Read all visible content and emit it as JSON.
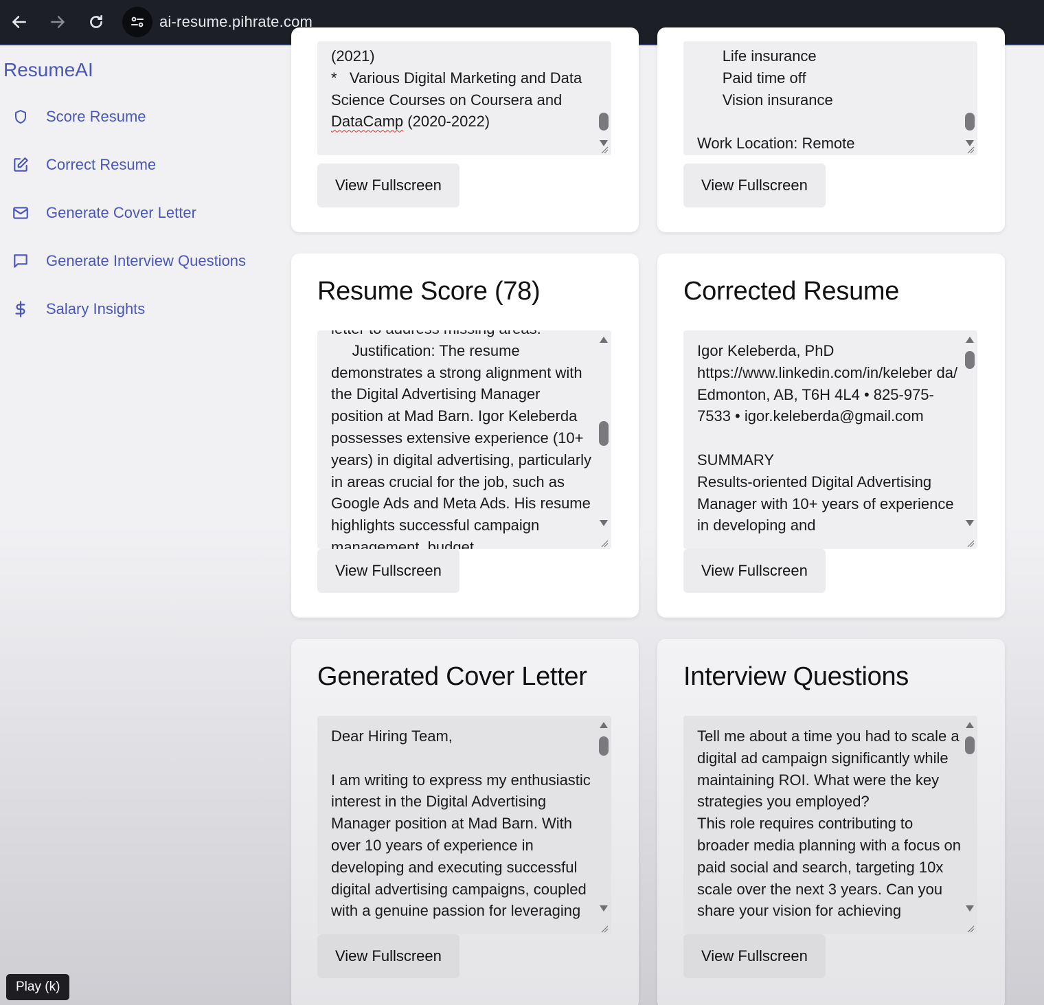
{
  "browser": {
    "url": "ai-resume.pihrate.com"
  },
  "sidebar": {
    "brand": "ResumeAI",
    "items": [
      {
        "label": "Score Resume",
        "icon": "shield-icon"
      },
      {
        "label": "Correct Resume",
        "icon": "edit-icon"
      },
      {
        "label": "Generate Cover Letter",
        "icon": "mail-icon"
      },
      {
        "label": "Generate Interview Questions",
        "icon": "chat-icon"
      },
      {
        "label": "Salary Insights",
        "icon": "dollar-icon"
      }
    ]
  },
  "cards": {
    "top_left": {
      "text_a": "(2021)\n*   Various Digital Marketing and Data Science Courses on Coursera and ",
      "text_b": "DataCamp",
      "text_c": " (2020-2022)",
      "button": "View Fullscreen"
    },
    "top_right": {
      "text": "      Life insurance\n      Paid time off\n      Vision insurance\n\nWork Location: Remote",
      "button": "View Fullscreen"
    },
    "resume_score": {
      "title": "Resume Score (78)",
      "text": "letter to address missing areas.\n     Justification: The resume demonstrates a strong alignment with the Digital Advertising Manager position at Mad Barn. Igor Keleberda possesses extensive experience (10+ years) in digital advertising, particularly in areas crucial for the job, such as Google Ads and Meta Ads. His resume highlights successful campaign management, budget",
      "button": "View Fullscreen"
    },
    "corrected_resume": {
      "title": "Corrected Resume",
      "text": "Igor Keleberda, PhD\nhttps://www.linkedin.com/in/keleber da/\nEdmonton, AB, T6H 4L4 • 825-975-7533 • igor.keleberda@gmail.com\n\nSUMMARY\nResults-oriented Digital Advertising Manager with 10+ years of experience in developing and",
      "button": "View Fullscreen"
    },
    "cover_letter": {
      "title": "Generated Cover Letter",
      "text": "Dear Hiring Team,\n\nI am writing to express my enthusiastic interest in the Digital Advertising Manager position at Mad Barn. With over 10 years of experience in developing and executing successful digital advertising campaigns, coupled with a genuine passion for leveraging",
      "button": "View Fullscreen"
    },
    "interview_questions": {
      "title": "Interview Questions",
      "text": "Tell me about a time you had to scale a digital ad campaign significantly while maintaining ROI. What were the key strategies you employed?\nThis role requires contributing to broader media planning with a focus on paid social and search, targeting 10x scale over the next 3 years. Can you share your vision for achieving",
      "button": "View Fullscreen"
    }
  },
  "overlay": {
    "play": "Play (k)"
  }
}
